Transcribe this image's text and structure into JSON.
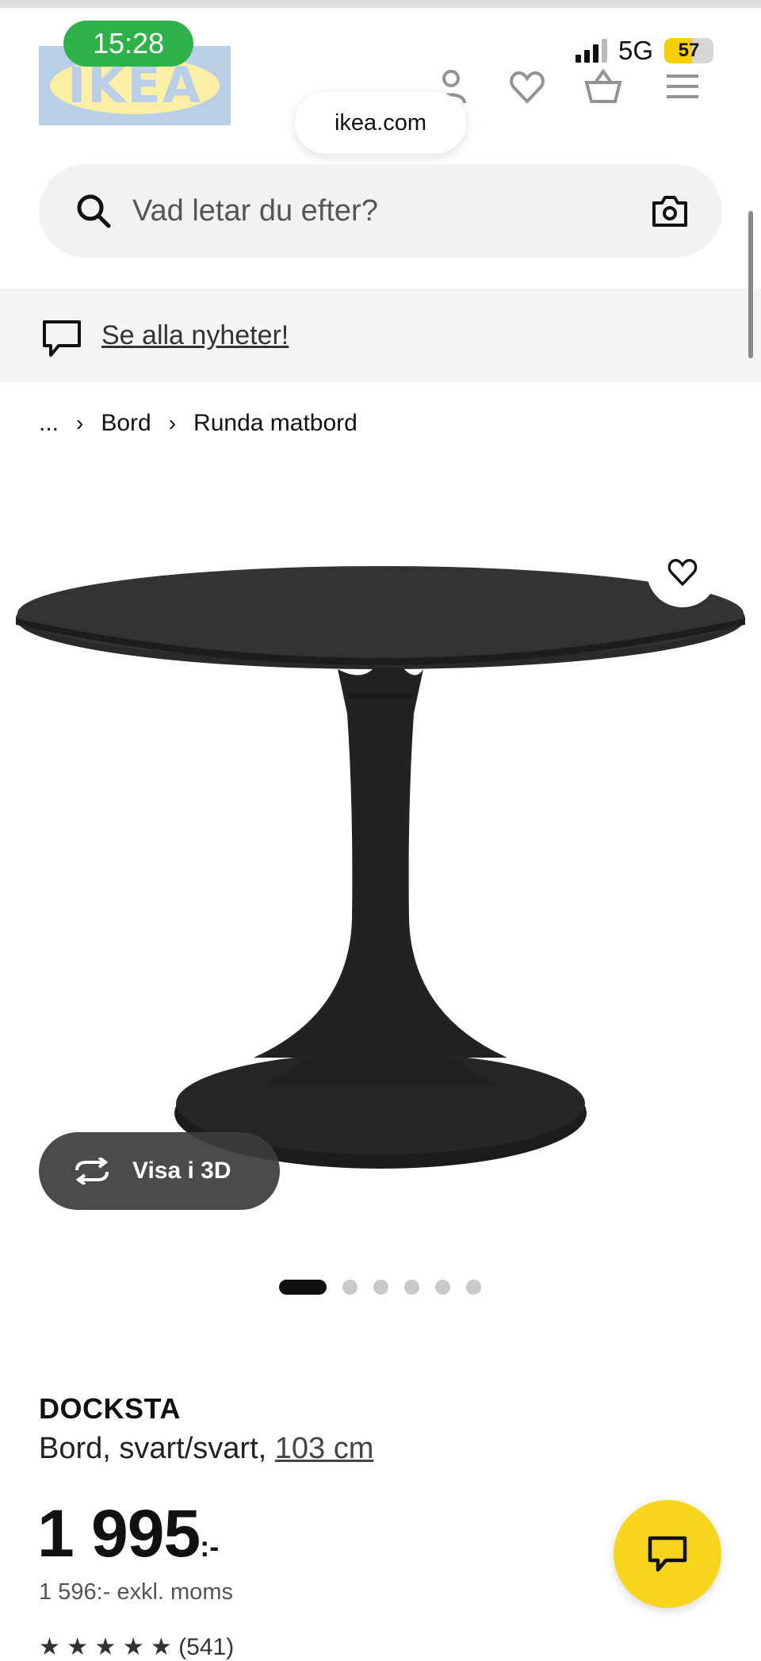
{
  "status_bar": {
    "time": "15:28",
    "network": "5G",
    "battery": "57",
    "battery_level_percent": 57
  },
  "header": {
    "logo_text": "IKEA",
    "url": "ikea.com",
    "icons": [
      "profile-icon",
      "heart-icon",
      "basket-icon",
      "menu-icon"
    ]
  },
  "search": {
    "placeholder": "Vad letar du efter?"
  },
  "news_banner": {
    "link_text": "Se alla nyheter!"
  },
  "breadcrumb": {
    "items": [
      "...",
      "Bord",
      "Runda matbord"
    ]
  },
  "gallery": {
    "view_3d_label": "Visa i 3D",
    "image_count": 6,
    "active_index": 0
  },
  "product": {
    "name": "DOCKSTA",
    "description": "Bord, svart/svart,",
    "size": "103 cm",
    "price": "1 995",
    "price_suffix": ":-",
    "price_excl_vat": "1 596:- exkl. moms",
    "partial_text": "★ ★ ★ ★ ★ (541)"
  },
  "colors": {
    "brand_yellow": "#f7d51d",
    "brand_blue": "#3a78bd",
    "status_green": "#2fb14a"
  }
}
